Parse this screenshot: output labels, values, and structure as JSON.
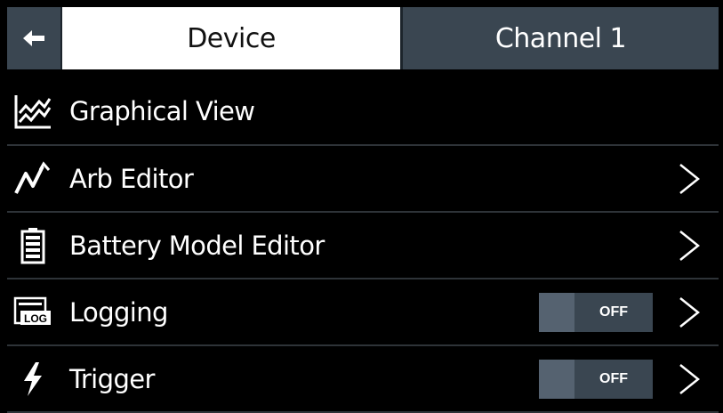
{
  "header": {
    "back_icon": "arrow-left-icon",
    "tab_device": "Device",
    "tab_channel": "Channel 1"
  },
  "menu": {
    "items": [
      {
        "label": "Graphical View",
        "icon": "chart-icon",
        "has_chevron": false
      },
      {
        "label": "Arb Editor",
        "icon": "waveform-icon",
        "has_chevron": true
      },
      {
        "label": "Battery Model Editor",
        "icon": "battery-icon",
        "has_chevron": true
      },
      {
        "label": "Logging",
        "icon": "log-icon",
        "has_chevron": true,
        "toggle": "OFF"
      },
      {
        "label": "Trigger",
        "icon": "lightning-icon",
        "has_chevron": true,
        "toggle": "OFF"
      }
    ]
  },
  "colors": {
    "background": "#000000",
    "tab_active": "#ffffff",
    "tab_inactive": "#3a4651",
    "toggle_bg": "#3a4651",
    "divider": "#2e3338"
  }
}
